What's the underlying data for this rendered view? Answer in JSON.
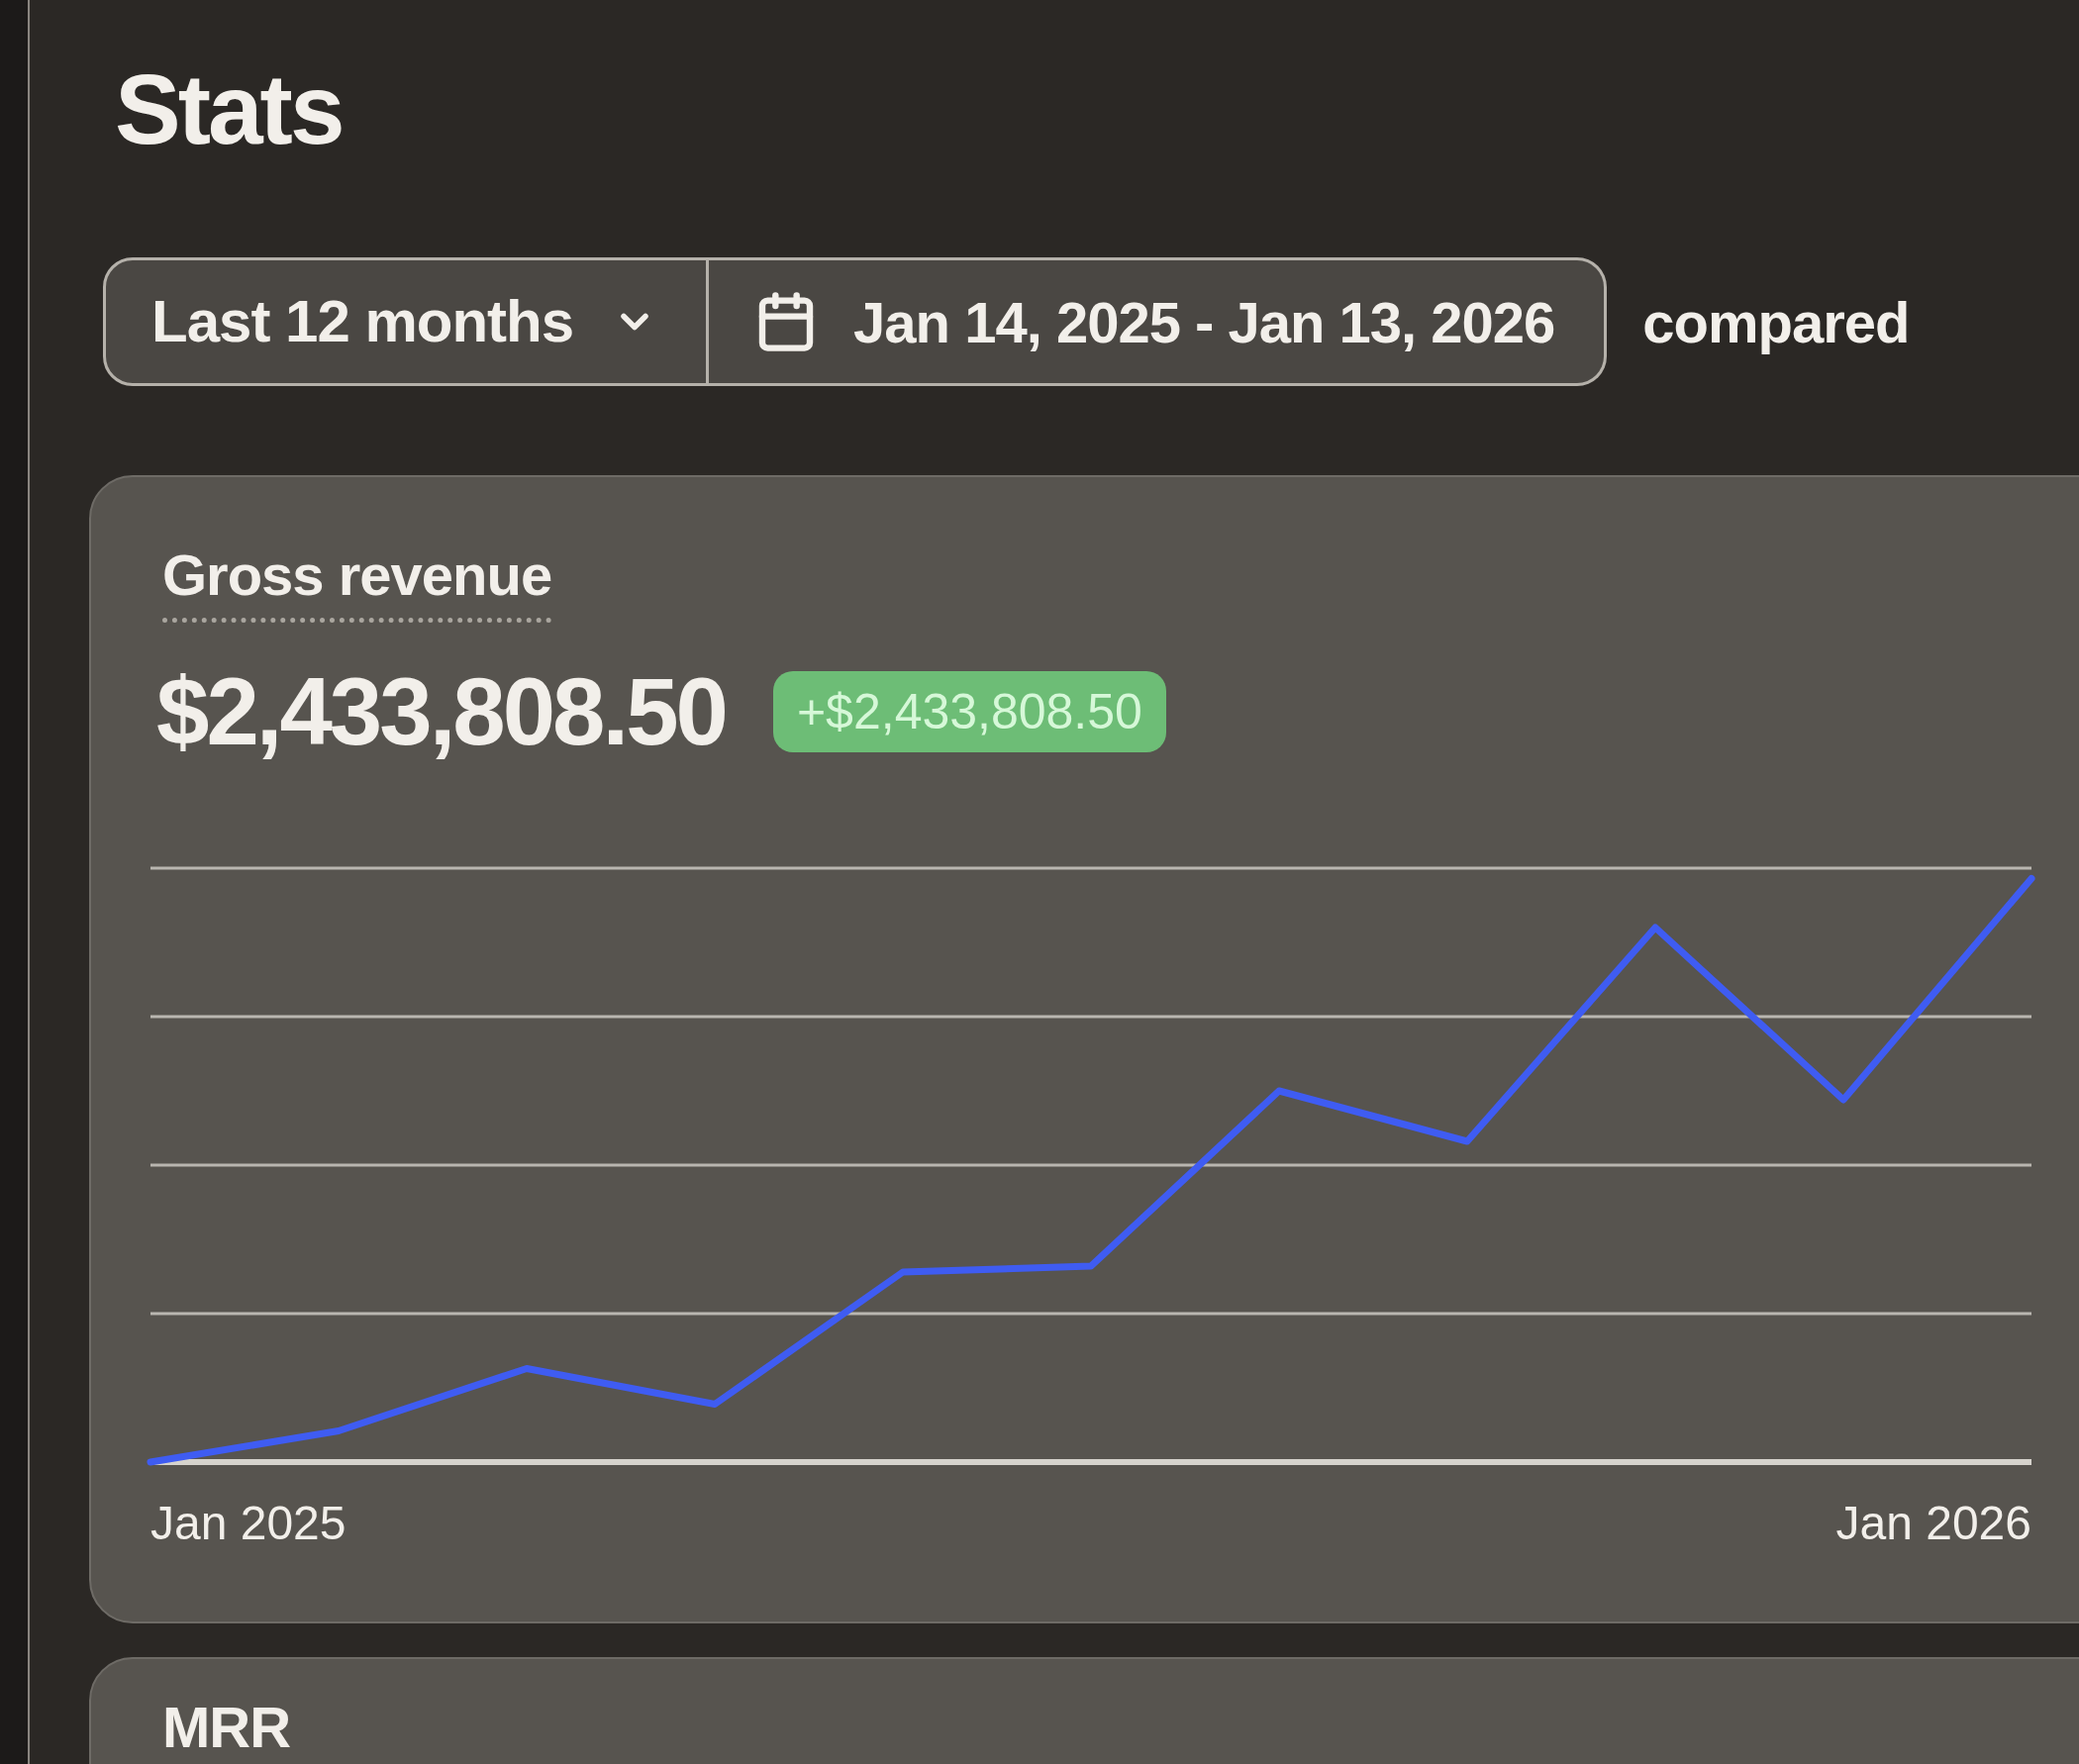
{
  "page": {
    "title": "Stats"
  },
  "filters": {
    "range_select": {
      "value": "Last 12 months"
    },
    "date_range": {
      "value": "Jan 14, 2025 - Jan 13, 2026"
    },
    "comparison_label": "compared"
  },
  "gross_revenue": {
    "title": "Gross revenue",
    "value": "$2,433,808.50",
    "change": "+$2,433,808.50",
    "chart": {
      "x_labels": [
        "Jan 2025",
        "Jan 2026"
      ]
    }
  },
  "mrr": {
    "title": "MRR"
  }
}
